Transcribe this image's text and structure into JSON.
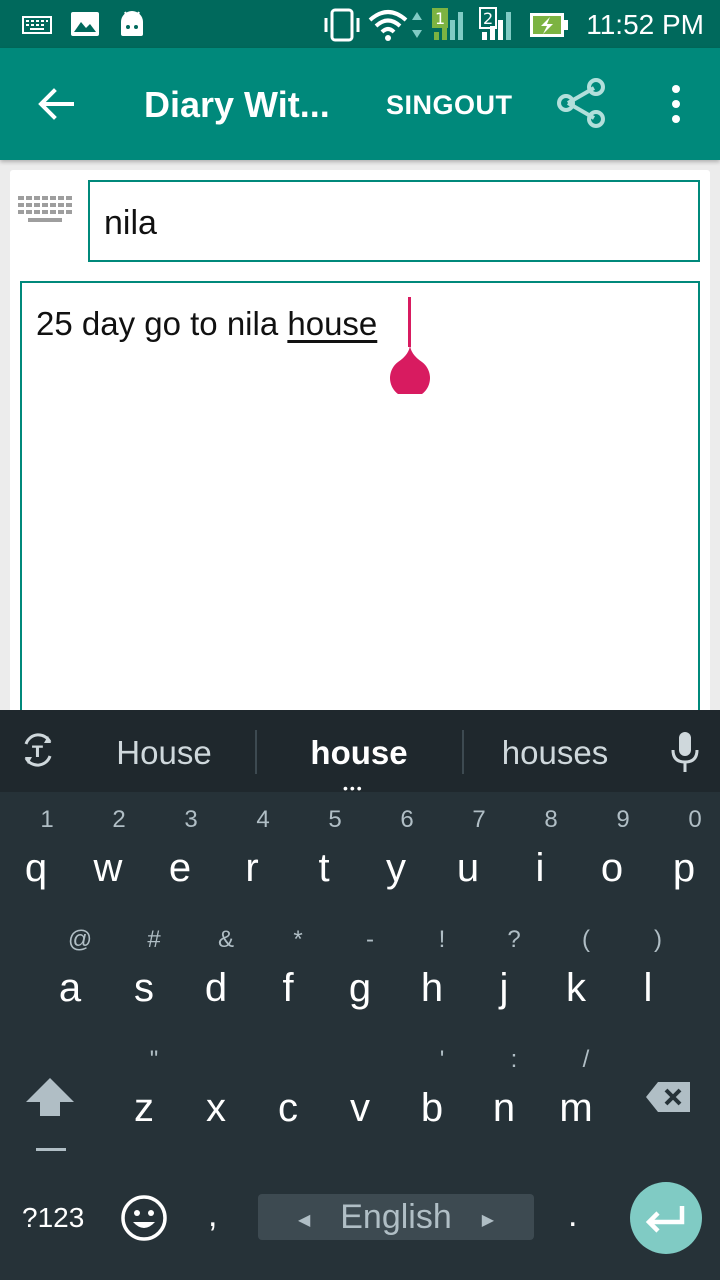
{
  "status_bar": {
    "time": "11:52 PM"
  },
  "app_bar": {
    "title": "Diary Wit...",
    "signout_label": "SINGOUT"
  },
  "editor": {
    "title_value": "nila",
    "body_prefix": "25 day go to nila ",
    "body_underlined": "house"
  },
  "keyboard": {
    "suggestions": [
      "House",
      "house",
      "houses"
    ],
    "row1": [
      {
        "key": "q",
        "hint": "1"
      },
      {
        "key": "w",
        "hint": "2"
      },
      {
        "key": "e",
        "hint": "3"
      },
      {
        "key": "r",
        "hint": "4"
      },
      {
        "key": "t",
        "hint": "5"
      },
      {
        "key": "y",
        "hint": "6"
      },
      {
        "key": "u",
        "hint": "7"
      },
      {
        "key": "i",
        "hint": "8"
      },
      {
        "key": "o",
        "hint": "9"
      },
      {
        "key": "p",
        "hint": "0"
      }
    ],
    "row2": [
      {
        "key": "a",
        "hint": "@"
      },
      {
        "key": "s",
        "hint": "#"
      },
      {
        "key": "d",
        "hint": "&"
      },
      {
        "key": "f",
        "hint": "*"
      },
      {
        "key": "g",
        "hint": "-"
      },
      {
        "key": "h",
        "hint": "!"
      },
      {
        "key": "j",
        "hint": "?"
      },
      {
        "key": "k",
        "hint": "("
      },
      {
        "key": "l",
        "hint": ")"
      }
    ],
    "row3": [
      {
        "key": "z",
        "hint": "\""
      },
      {
        "key": "x",
        "hint": ""
      },
      {
        "key": "c",
        "hint": ""
      },
      {
        "key": "v",
        "hint": ""
      },
      {
        "key": "b",
        "hint": "'"
      },
      {
        "key": "n",
        "hint": ":"
      },
      {
        "key": "m",
        "hint": "/"
      }
    ],
    "symbols_label": "?123",
    "comma": ",",
    "period": ".",
    "language": "English"
  },
  "colors": {
    "primary": "#00897b",
    "primary_dark": "#00695c",
    "accent": "#d81b60",
    "keyboard_bg": "#263238",
    "enter_key": "#80cbc4"
  }
}
